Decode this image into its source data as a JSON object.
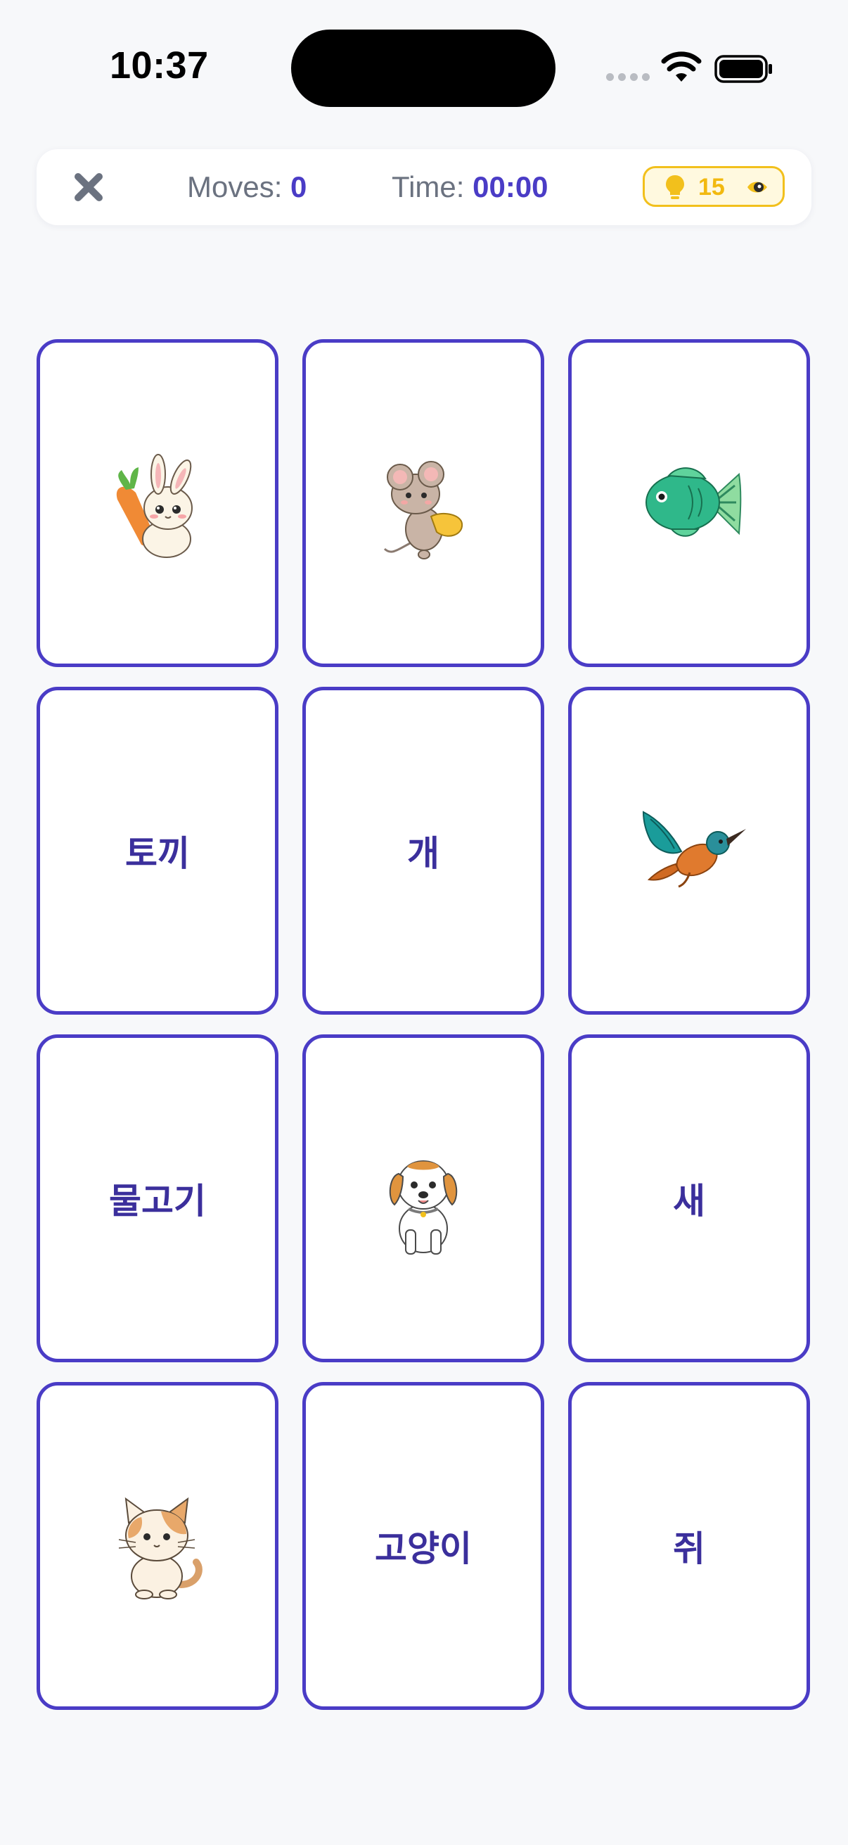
{
  "status_bar": {
    "time": "10:37"
  },
  "header": {
    "close_icon": "close-x-icon",
    "moves_label": "Moves:",
    "moves_value": "0",
    "time_label": "Time:",
    "time_value": "00:00",
    "hints_count": "15",
    "hint_icon": "lightbulb-icon"
  },
  "colors": {
    "accent": "#4a3cc6",
    "word_text": "#3b2f9c",
    "hint_yellow": "#f2c01c",
    "background": "#f7f8fa"
  },
  "cards": [
    {
      "kind": "image",
      "icon": "rabbit-with-carrot-icon"
    },
    {
      "kind": "image",
      "icon": "mouse-icon"
    },
    {
      "kind": "image",
      "icon": "fish-icon"
    },
    {
      "kind": "word",
      "text": "토끼"
    },
    {
      "kind": "word",
      "text": "개"
    },
    {
      "kind": "image",
      "icon": "bird-icon"
    },
    {
      "kind": "word",
      "text": "물고기"
    },
    {
      "kind": "image",
      "icon": "dog-icon"
    },
    {
      "kind": "word",
      "text": "새"
    },
    {
      "kind": "image",
      "icon": "cat-icon"
    },
    {
      "kind": "word",
      "text": "고양이"
    },
    {
      "kind": "word",
      "text": "쥐"
    }
  ]
}
